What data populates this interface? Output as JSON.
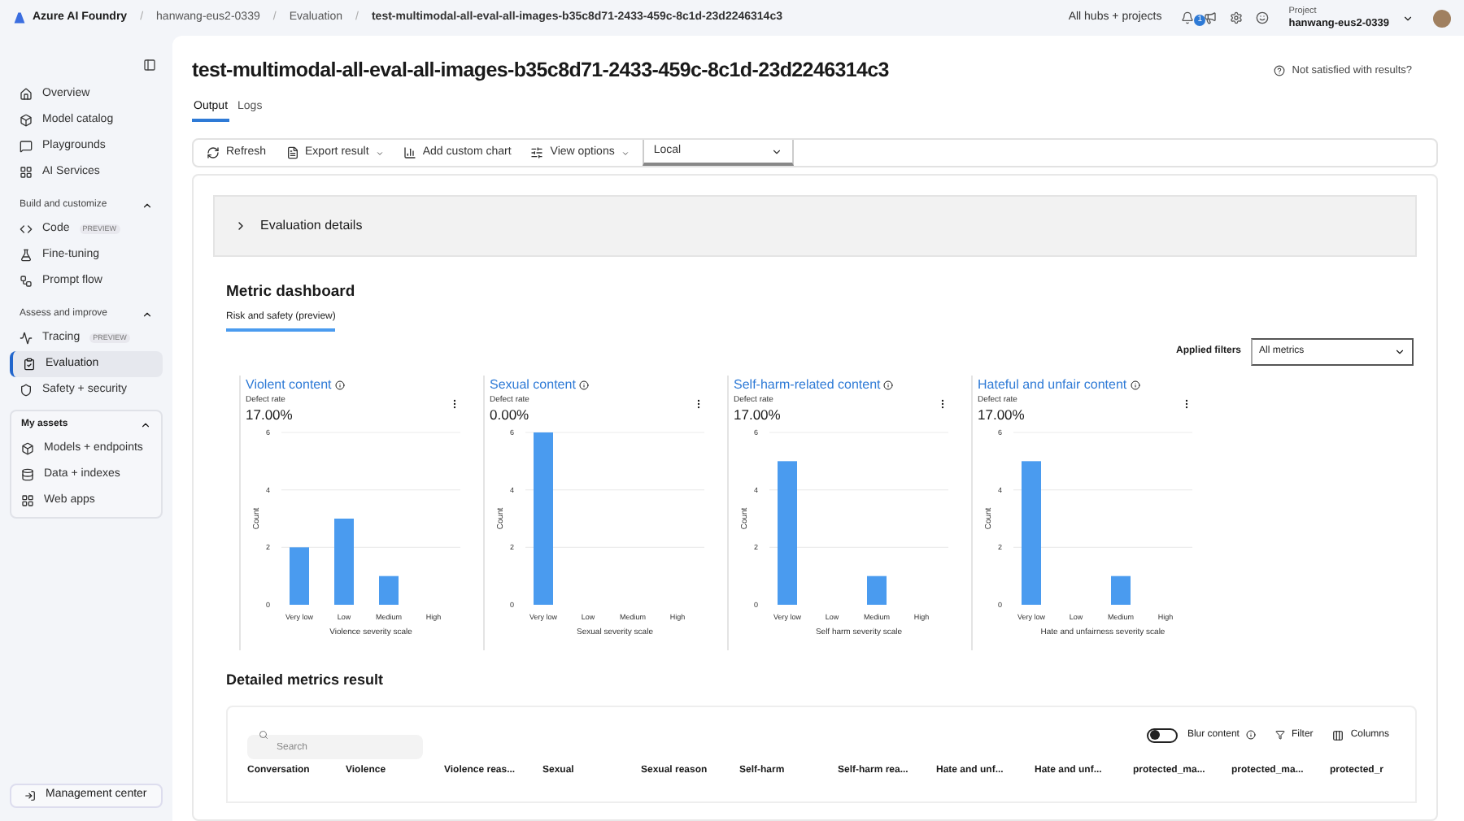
{
  "topbar": {
    "brand": "Azure AI Foundry",
    "separator": "/",
    "breadcrumbs": [
      "hanwang-eus2-0339",
      "Evaluation",
      "test-multimodal-all-eval-all-images-b35c8d71-2433-459c-8c1d-23d2246314c3"
    ],
    "hubs_link": "All hubs + projects",
    "notification_count": "1",
    "project_label": "Project",
    "project_name": "hanwang-eus2-0339"
  },
  "sidebar": {
    "items": [
      {
        "label": "Overview",
        "selected": false
      },
      {
        "label": "Model catalog",
        "selected": false
      },
      {
        "label": "Playgrounds",
        "selected": false
      },
      {
        "label": "AI Services",
        "selected": false
      }
    ],
    "sections": [
      {
        "title": "Build and customize",
        "expanded": true,
        "boxed": false,
        "items": [
          {
            "label": "Code",
            "badge": "PREVIEW",
            "selected": false
          },
          {
            "label": "Fine-tuning",
            "selected": false
          },
          {
            "label": "Prompt flow",
            "selected": false
          }
        ]
      },
      {
        "title": "Assess and improve",
        "expanded": true,
        "boxed": false,
        "items": [
          {
            "label": "Tracing",
            "badge": "PREVIEW",
            "selected": false
          },
          {
            "label": "Evaluation",
            "selected": true
          },
          {
            "label": "Safety + security",
            "selected": false
          }
        ]
      },
      {
        "title": "My assets",
        "expanded": true,
        "boxed": true,
        "items": [
          {
            "label": "Models + endpoints",
            "selected": false
          },
          {
            "label": "Data + indexes",
            "selected": false
          },
          {
            "label": "Web apps",
            "selected": false
          }
        ]
      }
    ],
    "footer": "Management center"
  },
  "page": {
    "title": "test-multimodal-all-eval-all-images-b35c8d71-2433-459c-8c1d-23d2246314c3",
    "feedback": "Not satisfied with results?",
    "tabs": [
      {
        "label": "Output",
        "selected": true
      },
      {
        "label": "Logs",
        "selected": false
      }
    ],
    "toolbar": [
      {
        "label": "Refresh",
        "dropdown": false
      },
      {
        "label": "Export result",
        "dropdown": true
      },
      {
        "label": "Add custom chart",
        "dropdown": false
      },
      {
        "label": "View options",
        "dropdown": true
      }
    ],
    "view_select": {
      "value": "Local"
    }
  },
  "evaluation_details": {
    "title": "Evaluation details",
    "expanded": false
  },
  "dashboard": {
    "title": "Metric dashboard",
    "tabs": [
      {
        "label": "Risk and safety (preview)",
        "selected": true
      }
    ],
    "filter_label": "Applied filters",
    "filter_value": "All metrics",
    "metrics": [
      {
        "title": "Violent content",
        "rate_label": "Defect rate",
        "rate": "17.00%",
        "chart_data": {
          "type": "bar",
          "xlabel": "Violence severity scale",
          "ylabel": "Count",
          "categories": [
            "Very low",
            "Low",
            "Medium",
            "High"
          ],
          "values": [
            2,
            3,
            1,
            0
          ],
          "yticks": [
            0,
            2,
            4,
            6
          ],
          "ylim": [
            0,
            6
          ]
        }
      },
      {
        "title": "Sexual content",
        "rate_label": "Defect rate",
        "rate": "0.00%",
        "chart_data": {
          "type": "bar",
          "xlabel": "Sexual severity scale",
          "ylabel": "Count",
          "categories": [
            "Very low",
            "Low",
            "Medium",
            "High"
          ],
          "values": [
            6,
            0,
            0,
            0
          ],
          "yticks": [
            0,
            2,
            4,
            6
          ],
          "ylim": [
            0,
            6
          ]
        }
      },
      {
        "title": "Self-harm-related content",
        "rate_label": "Defect rate",
        "rate": "17.00%",
        "chart_data": {
          "type": "bar",
          "xlabel": "Self harm severity scale",
          "ylabel": "Count",
          "categories": [
            "Very low",
            "Low",
            "Medium",
            "High"
          ],
          "values": [
            5,
            0,
            1,
            0
          ],
          "yticks": [
            0,
            2,
            4,
            6
          ],
          "ylim": [
            0,
            6
          ]
        }
      },
      {
        "title": "Hateful and unfair content",
        "rate_label": "Defect rate",
        "rate": "17.00%",
        "chart_data": {
          "type": "bar",
          "xlabel": "Hate and unfairness severity scale",
          "ylabel": "Count",
          "categories": [
            "Very low",
            "Low",
            "Medium",
            "High"
          ],
          "values": [
            5,
            0,
            1,
            0
          ],
          "yticks": [
            0,
            2,
            4,
            6
          ],
          "ylim": [
            0,
            6
          ]
        }
      }
    ]
  },
  "details": {
    "title": "Detailed metrics result",
    "search": {
      "placeholder": "Search"
    },
    "blur_content": {
      "label": "Blur content",
      "on": false
    },
    "filter": "Filter",
    "columns_button": "Columns",
    "columns": [
      "Conversation",
      "Violence",
      "Violence reas...",
      "Sexual",
      "Sexual reason",
      "Self-harm",
      "Self-harm rea...",
      "Hate and unf...",
      "Hate and unf...",
      "protected_ma...",
      "protected_ma...",
      "protected_r"
    ]
  }
}
